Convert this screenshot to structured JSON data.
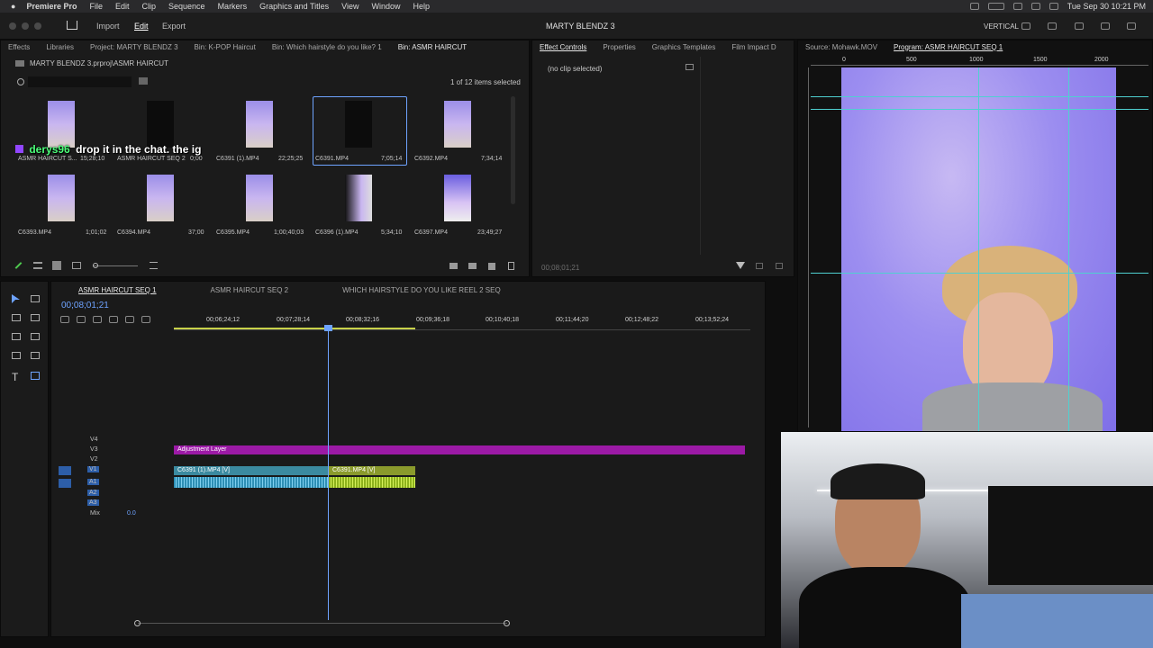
{
  "menubar": {
    "app": "Premiere Pro",
    "items": [
      "File",
      "Edit",
      "Clip",
      "Sequence",
      "Markers",
      "Graphics and Titles",
      "View",
      "Window",
      "Help"
    ],
    "clock": "Tue Sep 30  10:21 PM"
  },
  "header": {
    "tabs": [
      "Import",
      "Edit",
      "Export"
    ],
    "title": "MARTY BLENDZ 3",
    "workspace": "VERTICAL"
  },
  "project_panel": {
    "tabs": [
      "Effects",
      "Libraries",
      "Project: MARTY BLENDZ 3",
      "Bin: K-POP Haircut",
      "Bin: Which hairstyle do you like? 1",
      "Bin: ASMR HAIRCUT"
    ],
    "path": "MARTY BLENDZ 3.prproj\\ASMR HAIRCUT",
    "search_placeholder": "",
    "selection_count": "1 of 12 items selected",
    "items": [
      {
        "name": "ASMR HAIRCUT S...",
        "duration": "15;28;10"
      },
      {
        "name": "ASMR HAIRCUT SEQ 2",
        "duration": "0;00"
      },
      {
        "name": "C6391 (1).MP4",
        "duration": "22;25;25"
      },
      {
        "name": "C6391.MP4",
        "duration": "7;05;14"
      },
      {
        "name": "C6392.MP4",
        "duration": "7;34;14"
      },
      {
        "name": "C6393.MP4",
        "duration": "1;01;02"
      },
      {
        "name": "C6394.MP4",
        "duration": "37;00"
      },
      {
        "name": "C6395.MP4",
        "duration": "1;00;40;03"
      },
      {
        "name": "C6396 (1).MP4",
        "duration": "5;34;10"
      },
      {
        "name": "C6397.MP4",
        "duration": "23;49;27"
      }
    ],
    "chat_user": "derys96",
    "chat_message": "drop it in the chat. the ig"
  },
  "effect_controls": {
    "tabs": [
      "Effect Controls",
      "Properties",
      "Graphics Templates",
      "Film Impact D"
    ],
    "status": "(no clip selected)",
    "timecode": "00;08;01;21"
  },
  "program_monitor": {
    "tabs": [
      "Source: Mohawk.MOV",
      "Program: ASMR HAIRCUT SEQ 1"
    ],
    "ruler": [
      "0",
      "500",
      "1000",
      "1500",
      "2000"
    ]
  },
  "timeline": {
    "tabs": [
      "ASMR HAIRCUT SEQ 1",
      "ASMR HAIRCUT SEQ 2",
      "WHICH HAIRSTYLE DO YOU LIKE REEL 2 SEQ"
    ],
    "timecode": "00;08;01;21",
    "ruler": [
      "00;06;24;12",
      "00;07;28;14",
      "00;08;32;16",
      "00;09;36;18",
      "00;10;40;18",
      "00;11;44;20",
      "00;12;48;22",
      "00;13;52;24"
    ],
    "video_tracks": [
      "V4",
      "V3",
      "V2",
      "V1"
    ],
    "audio_tracks": [
      "A1",
      "A2",
      "A3"
    ],
    "mix_label": "Mix",
    "mix_value": "0.0",
    "adjustment_label": "Adjustment Layer",
    "clip1": "C6391 (1).MP4 [V]",
    "clip2": "C6391.MP4 [V]"
  }
}
